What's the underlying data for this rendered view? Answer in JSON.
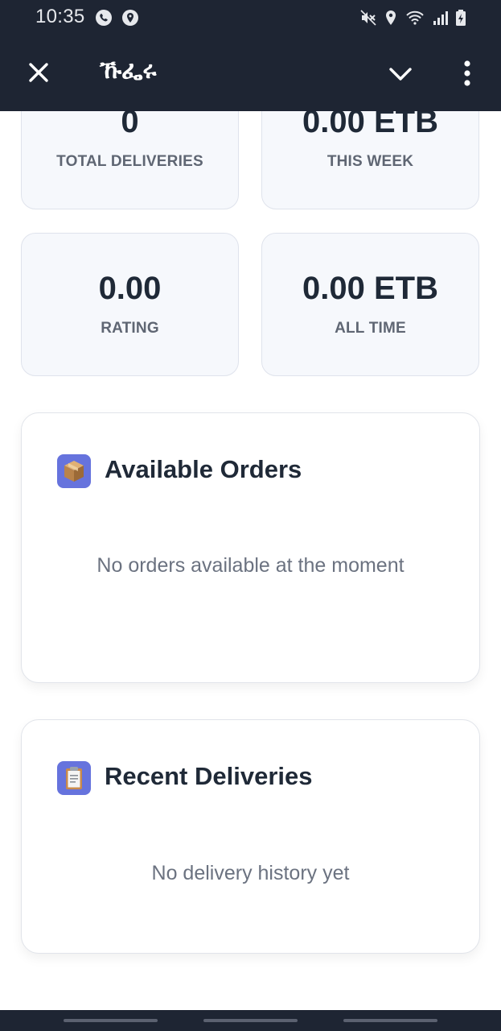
{
  "status_bar": {
    "time": "10:35",
    "icons": [
      "whatsapp-icon",
      "location-icon",
      "mute-icon",
      "location-icon",
      "wifi-icon",
      "signal-icon",
      "battery-charging-icon"
    ]
  },
  "app_bar": {
    "title": "ኹፌሩ",
    "close_icon": "close-icon",
    "chevron_icon": "chevron-down-icon",
    "menu_icon": "more-vert-icon"
  },
  "stats": [
    {
      "value": "0",
      "label": "TOTAL DELIVERIES"
    },
    {
      "value": "0.00 ETB",
      "label": "THIS WEEK"
    },
    {
      "value": "0.00",
      "label": "RATING"
    },
    {
      "value": "0.00 ETB",
      "label": "ALL TIME"
    }
  ],
  "available_orders": {
    "icon": "package-icon",
    "title": "Available Orders",
    "empty_text": "No orders available at the moment"
  },
  "recent_deliveries": {
    "icon": "clipboard-icon",
    "title": "Recent Deliveries",
    "empty_text": "No delivery history yet"
  },
  "colors": {
    "app_bar": "#1e2533",
    "card_bg": "#f6f8fc",
    "icon_bg": "#6673dd",
    "text_primary": "#1f2937",
    "text_muted": "#6b7280"
  }
}
